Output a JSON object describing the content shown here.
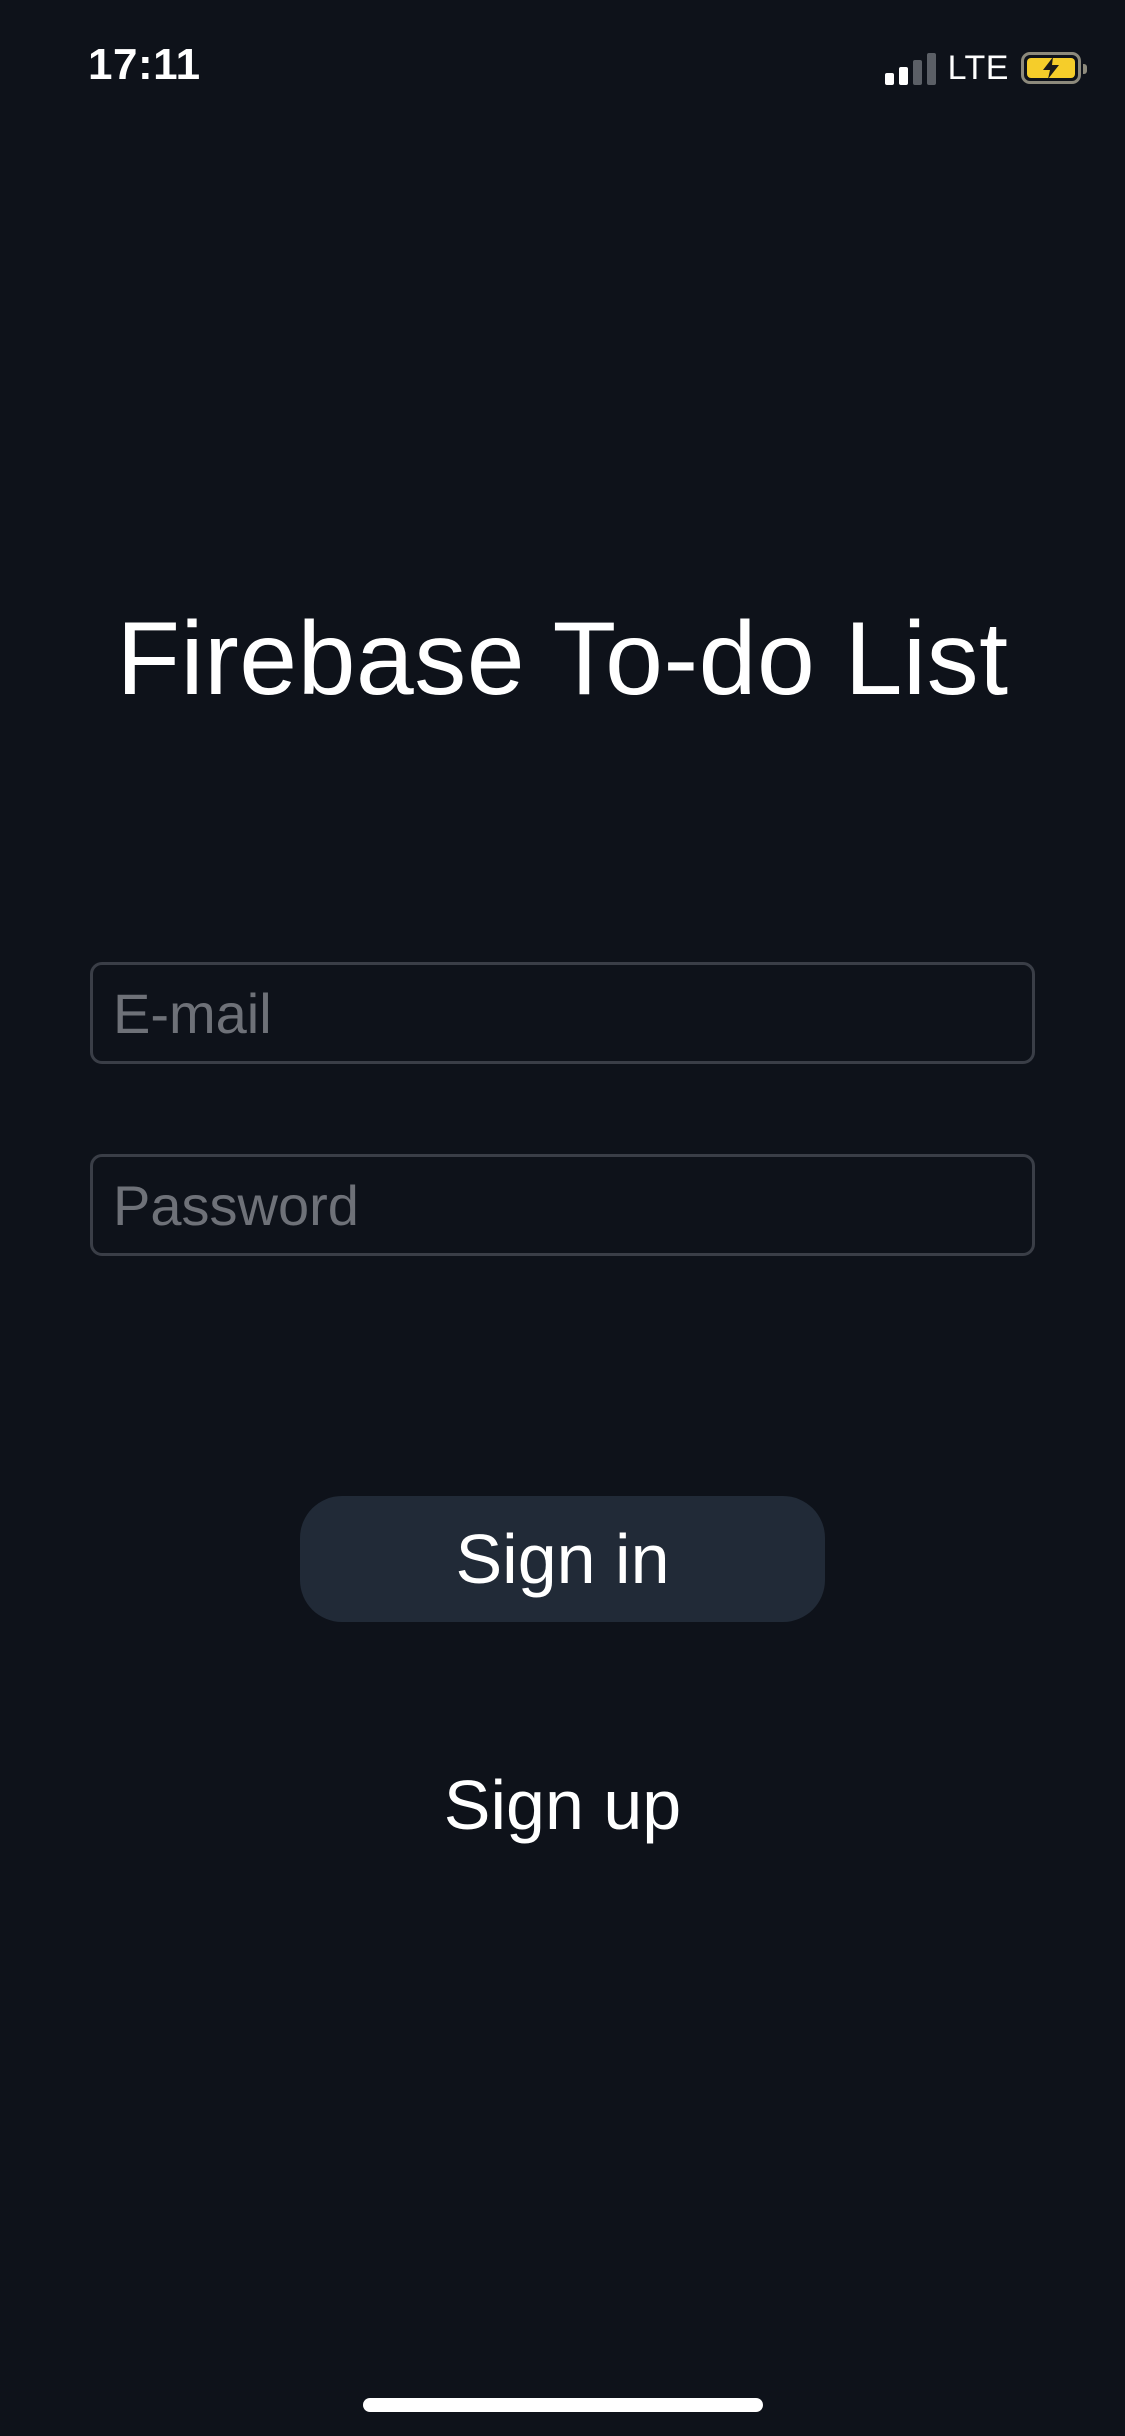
{
  "status_bar": {
    "time": "17:11",
    "network": "LTE",
    "signal_bars_active": 2,
    "signal_bars_total": 4,
    "battery_charging": true,
    "battery_color": "#f5cd2a"
  },
  "app": {
    "title": "Firebase To-do List"
  },
  "form": {
    "email_placeholder": "E-mail",
    "email_value": "",
    "password_placeholder": "Password",
    "password_value": ""
  },
  "actions": {
    "sign_in_label": "Sign in",
    "sign_up_label": "Sign up"
  },
  "colors": {
    "background": "#0e121a",
    "button_background": "#212a37",
    "input_border": "#3a3e47",
    "placeholder": "#6e7178",
    "text": "#ffffff"
  },
  "icons": {
    "signal": "cellular-signal-icon",
    "battery": "battery-charging-icon"
  }
}
